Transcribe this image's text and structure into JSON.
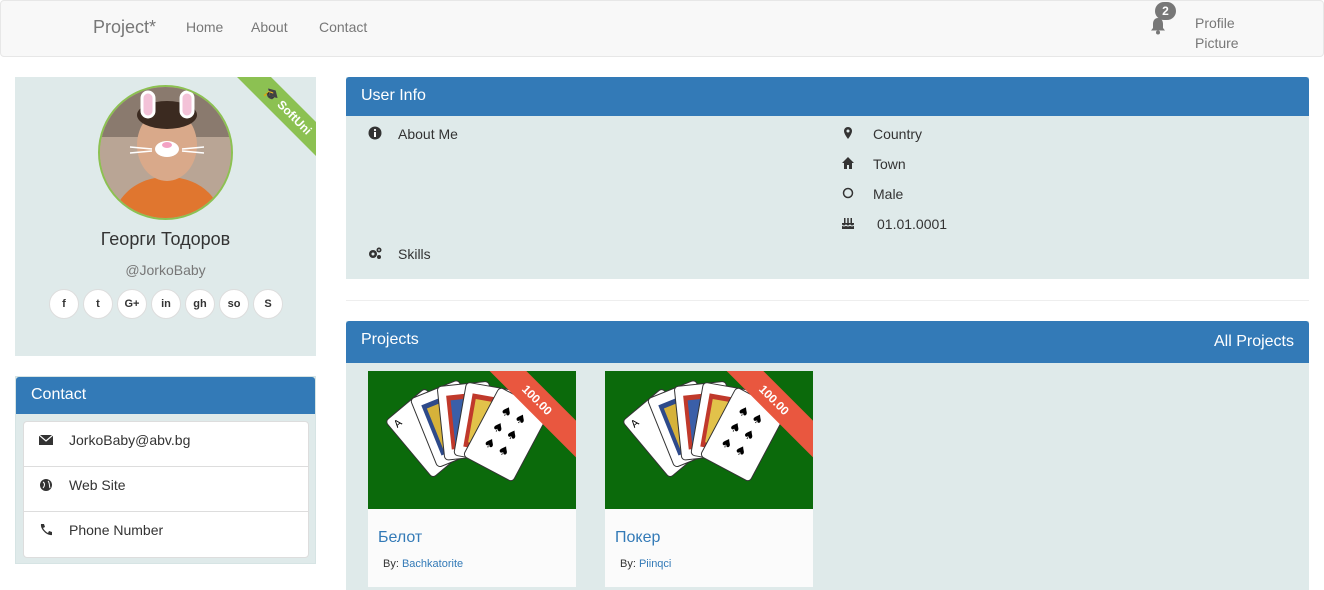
{
  "navbar": {
    "brand": "Project*",
    "links": [
      "Home",
      "About",
      "Contact"
    ],
    "notification_count": "2",
    "profile_picture_line1": "Profile",
    "profile_picture_line2": "Picture"
  },
  "profile": {
    "ribbon": "SoftUni",
    "name": "Георги Тодоров",
    "username": "@JorkoBaby",
    "socials": [
      "facebook-icon",
      "twitter-icon",
      "google-plus-icon",
      "linkedin-icon",
      "github-icon",
      "stackoverflow-icon",
      "skype-icon"
    ],
    "social_glyphs": [
      "f",
      "t",
      "G+",
      "in",
      "gh",
      "so",
      "S"
    ]
  },
  "contact": {
    "title": "Contact",
    "email": "JorkoBaby@abv.bg",
    "website": "Web Site",
    "phone": "Phone Number"
  },
  "user_info": {
    "title": "User Info",
    "about_me": "About Me",
    "skills": "Skills",
    "country": "Country",
    "town": "Town",
    "gender": "Male",
    "birthday": "01.01.0001"
  },
  "projects": {
    "title": "Projects",
    "all_projects": "All Projects",
    "items": [
      {
        "price": "100.00",
        "title": "Белот",
        "by_label": "By:",
        "author": "Bachkatorite"
      },
      {
        "price": "100.00",
        "title": "Покер",
        "by_label": "By:",
        "author": "Piinqci"
      }
    ]
  },
  "colors": {
    "primary": "#337ab7",
    "panel_bg": "#dfeaea",
    "ribbon_green": "#8cc152",
    "ribbon_red": "#e9573f",
    "card_green": "#0b6a0b"
  }
}
